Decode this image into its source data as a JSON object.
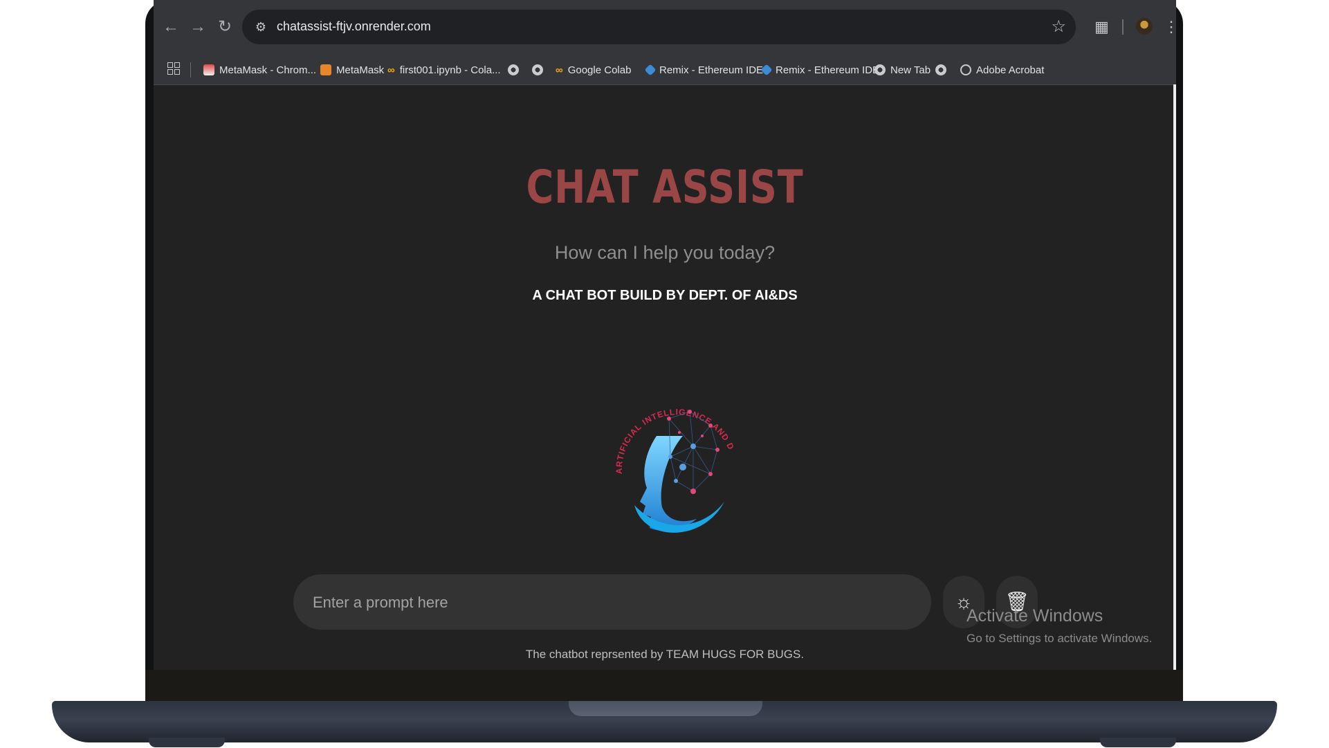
{
  "browser": {
    "url": "chatassist-ftjv.onrender.com",
    "bookmarks": [
      {
        "label": "MetaMask - Chrom...",
        "icon": "metamask-store-icon"
      },
      {
        "label": "MetaMask",
        "icon": "metamask-fox-icon"
      },
      {
        "label": "first001.ipynb - Cola...",
        "icon": "colab-icon"
      },
      {
        "label": "",
        "icon": "globe-icon"
      },
      {
        "label": "",
        "icon": "globe-icon"
      },
      {
        "label": "Google Colab",
        "icon": "colab-icon"
      },
      {
        "label": "Remix - Ethereum IDE",
        "icon": "remix-icon"
      },
      {
        "label": "Remix - Ethereum IDE",
        "icon": "remix-icon"
      },
      {
        "label": "New Tab",
        "icon": "globe-icon"
      },
      {
        "label": "",
        "icon": "globe-icon"
      },
      {
        "label": "Adobe Acrobat",
        "icon": "globe-icon"
      }
    ]
  },
  "page": {
    "title": "CHAT ASSIST",
    "subtitle": "How can I help you today?",
    "tagline": "A CHAT BOT BUILD BY DEPT. OF AI&DS",
    "logo_text": "ARTIFICIAL INTELLIGENCE AND DATA SCIENCE",
    "prompt_placeholder": "Enter a prompt here",
    "footer": "The chatbot reprsented by TEAM HUGS FOR BUGS.",
    "theme_icon": "sun-icon",
    "delete_icon": "trash-icon"
  },
  "os_overlay": {
    "activate_title": "Activate Windows",
    "activate_sub": "Go to Settings to activate Windows."
  },
  "colors": {
    "title": "#9b4646",
    "background": "#222222",
    "prompt_bar": "#333333"
  }
}
